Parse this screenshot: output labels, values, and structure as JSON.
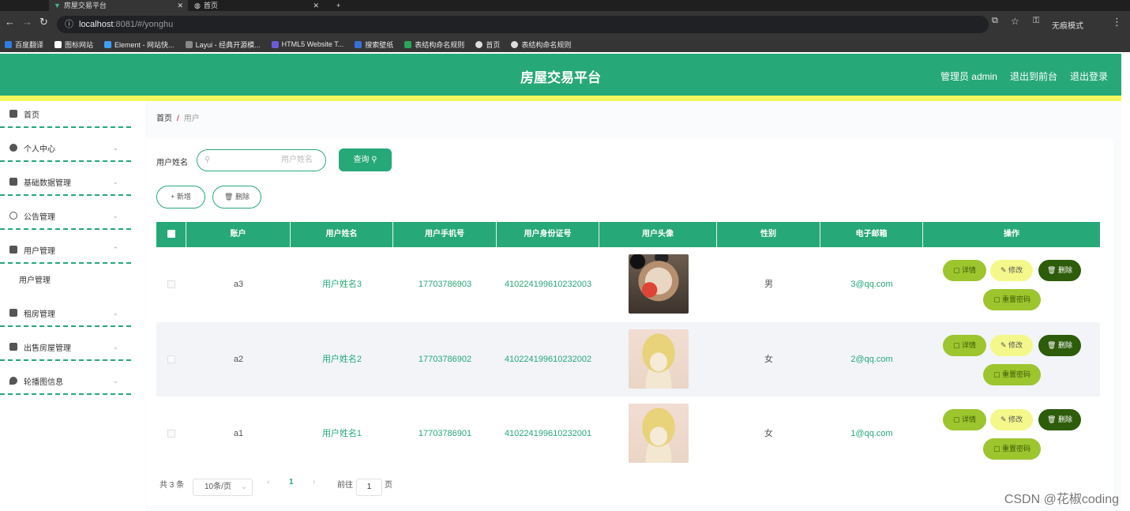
{
  "browser": {
    "tabs": [
      {
        "title": "房屋交易平台"
      },
      {
        "title": "首页"
      }
    ],
    "url_host": "localhost",
    "url_rest": ":8081/#/yonghu",
    "incognito_label": "无痕模式",
    "bookmarks": [
      "百度翻译",
      "图标网站",
      "Element - 网站快...",
      "Layui - 经典开源模...",
      "HTML5 Website T...",
      "搜索壁纸",
      "表结构命名规则",
      "首页",
      "表结构命名规则"
    ]
  },
  "header": {
    "title": "房屋交易平台",
    "admin_label": "管理员 admin",
    "to_front": "退出到前台",
    "logout": "退出登录"
  },
  "sidebar": {
    "items": [
      {
        "label": "首页"
      },
      {
        "label": "个人中心"
      },
      {
        "label": "基础数据管理"
      },
      {
        "label": "公告管理"
      },
      {
        "label": "用户管理"
      },
      {
        "label": "租房管理"
      },
      {
        "label": "出售房屋管理"
      },
      {
        "label": "轮播图信息"
      }
    ],
    "sub_item": "用户管理"
  },
  "breadcrumb": {
    "home": "首页",
    "sep": "/",
    "current": "用户"
  },
  "search": {
    "label": "用户姓名",
    "placeholder": "用户姓名",
    "button": "查询"
  },
  "actions": {
    "add": "新增",
    "delete": "删除"
  },
  "table": {
    "headers": [
      "账户",
      "用户姓名",
      "用户手机号",
      "用户身份证号",
      "用户头像",
      "性别",
      "电子邮箱",
      "操作"
    ],
    "rows": [
      {
        "account": "a3",
        "name": "用户姓名3",
        "phone": "17703786903",
        "idcard": "410224199610232003",
        "gender": "男",
        "email": "3@qq.com"
      },
      {
        "account": "a2",
        "name": "用户姓名2",
        "phone": "17703786902",
        "idcard": "410224199610232002",
        "gender": "女",
        "email": "2@qq.com"
      },
      {
        "account": "a1",
        "name": "用户姓名1",
        "phone": "17703786901",
        "idcard": "410224199610232001",
        "gender": "女",
        "email": "1@qq.com"
      }
    ],
    "ops": {
      "detail": "详情",
      "edit": "修改",
      "delete": "删除",
      "reset": "重置密码"
    }
  },
  "pagination": {
    "total": "共 3 条",
    "page_size": "10条/页",
    "current_page": "1",
    "goto": "前往",
    "goto_value": "1",
    "page_unit": "页"
  },
  "watermark": "CSDN @花椒coding"
}
